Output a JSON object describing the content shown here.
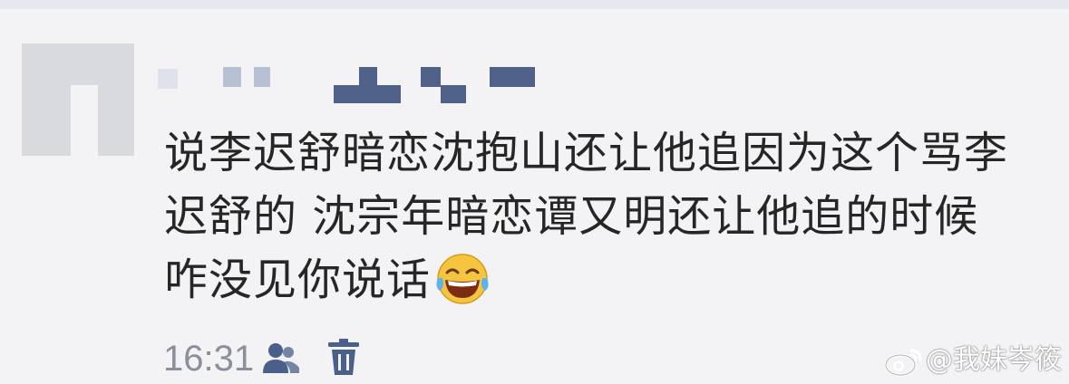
{
  "comment": {
    "lines": [
      "说李迟舒暗恋沈抱山还让他追因为这个骂李",
      "迟舒的 沈宗年暗恋谭又明还让他追的时候",
      "咋没见你说话"
    ],
    "emoji": "tears-of-joy-emoji"
  },
  "footer": {
    "time": "16:31",
    "icons": [
      "people-icon",
      "trash-icon"
    ]
  },
  "watermark": {
    "text": "@我妹岑筱"
  },
  "colors": {
    "background": "#f3f3f6",
    "text": "#262626",
    "muted": "#8b8f9a",
    "icon_blue": "#4a5f8a",
    "mosaic": "#4f6189"
  }
}
